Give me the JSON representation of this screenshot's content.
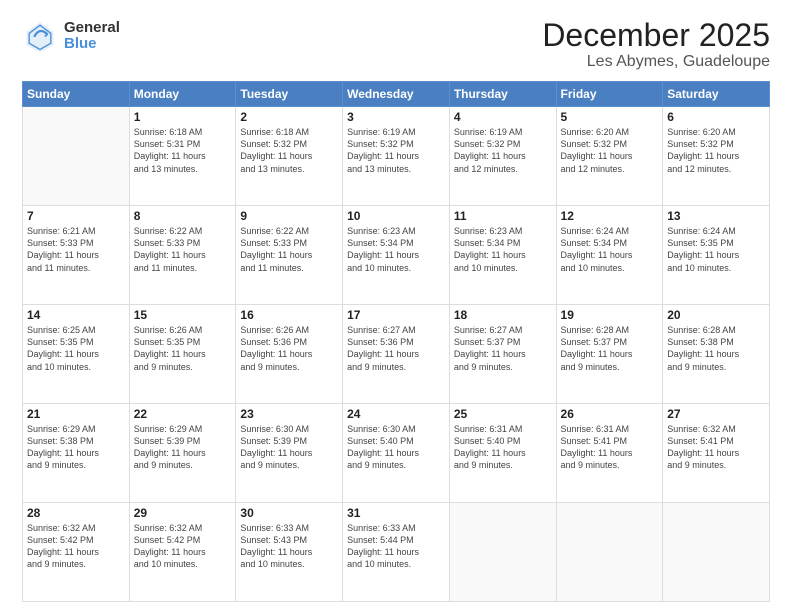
{
  "logo": {
    "general": "General",
    "blue": "Blue"
  },
  "title": "December 2025",
  "location": "Les Abymes, Guadeloupe",
  "headers": [
    "Sunday",
    "Monday",
    "Tuesday",
    "Wednesday",
    "Thursday",
    "Friday",
    "Saturday"
  ],
  "weeks": [
    [
      {
        "day": "",
        "info": ""
      },
      {
        "day": "1",
        "info": "Sunrise: 6:18 AM\nSunset: 5:31 PM\nDaylight: 11 hours\nand 13 minutes."
      },
      {
        "day": "2",
        "info": "Sunrise: 6:18 AM\nSunset: 5:32 PM\nDaylight: 11 hours\nand 13 minutes."
      },
      {
        "day": "3",
        "info": "Sunrise: 6:19 AM\nSunset: 5:32 PM\nDaylight: 11 hours\nand 13 minutes."
      },
      {
        "day": "4",
        "info": "Sunrise: 6:19 AM\nSunset: 5:32 PM\nDaylight: 11 hours\nand 12 minutes."
      },
      {
        "day": "5",
        "info": "Sunrise: 6:20 AM\nSunset: 5:32 PM\nDaylight: 11 hours\nand 12 minutes."
      },
      {
        "day": "6",
        "info": "Sunrise: 6:20 AM\nSunset: 5:32 PM\nDaylight: 11 hours\nand 12 minutes."
      }
    ],
    [
      {
        "day": "7",
        "info": "Sunrise: 6:21 AM\nSunset: 5:33 PM\nDaylight: 11 hours\nand 11 minutes."
      },
      {
        "day": "8",
        "info": "Sunrise: 6:22 AM\nSunset: 5:33 PM\nDaylight: 11 hours\nand 11 minutes."
      },
      {
        "day": "9",
        "info": "Sunrise: 6:22 AM\nSunset: 5:33 PM\nDaylight: 11 hours\nand 11 minutes."
      },
      {
        "day": "10",
        "info": "Sunrise: 6:23 AM\nSunset: 5:34 PM\nDaylight: 11 hours\nand 10 minutes."
      },
      {
        "day": "11",
        "info": "Sunrise: 6:23 AM\nSunset: 5:34 PM\nDaylight: 11 hours\nand 10 minutes."
      },
      {
        "day": "12",
        "info": "Sunrise: 6:24 AM\nSunset: 5:34 PM\nDaylight: 11 hours\nand 10 minutes."
      },
      {
        "day": "13",
        "info": "Sunrise: 6:24 AM\nSunset: 5:35 PM\nDaylight: 11 hours\nand 10 minutes."
      }
    ],
    [
      {
        "day": "14",
        "info": "Sunrise: 6:25 AM\nSunset: 5:35 PM\nDaylight: 11 hours\nand 10 minutes."
      },
      {
        "day": "15",
        "info": "Sunrise: 6:26 AM\nSunset: 5:35 PM\nDaylight: 11 hours\nand 9 minutes."
      },
      {
        "day": "16",
        "info": "Sunrise: 6:26 AM\nSunset: 5:36 PM\nDaylight: 11 hours\nand 9 minutes."
      },
      {
        "day": "17",
        "info": "Sunrise: 6:27 AM\nSunset: 5:36 PM\nDaylight: 11 hours\nand 9 minutes."
      },
      {
        "day": "18",
        "info": "Sunrise: 6:27 AM\nSunset: 5:37 PM\nDaylight: 11 hours\nand 9 minutes."
      },
      {
        "day": "19",
        "info": "Sunrise: 6:28 AM\nSunset: 5:37 PM\nDaylight: 11 hours\nand 9 minutes."
      },
      {
        "day": "20",
        "info": "Sunrise: 6:28 AM\nSunset: 5:38 PM\nDaylight: 11 hours\nand 9 minutes."
      }
    ],
    [
      {
        "day": "21",
        "info": "Sunrise: 6:29 AM\nSunset: 5:38 PM\nDaylight: 11 hours\nand 9 minutes."
      },
      {
        "day": "22",
        "info": "Sunrise: 6:29 AM\nSunset: 5:39 PM\nDaylight: 11 hours\nand 9 minutes."
      },
      {
        "day": "23",
        "info": "Sunrise: 6:30 AM\nSunset: 5:39 PM\nDaylight: 11 hours\nand 9 minutes."
      },
      {
        "day": "24",
        "info": "Sunrise: 6:30 AM\nSunset: 5:40 PM\nDaylight: 11 hours\nand 9 minutes."
      },
      {
        "day": "25",
        "info": "Sunrise: 6:31 AM\nSunset: 5:40 PM\nDaylight: 11 hours\nand 9 minutes."
      },
      {
        "day": "26",
        "info": "Sunrise: 6:31 AM\nSunset: 5:41 PM\nDaylight: 11 hours\nand 9 minutes."
      },
      {
        "day": "27",
        "info": "Sunrise: 6:32 AM\nSunset: 5:41 PM\nDaylight: 11 hours\nand 9 minutes."
      }
    ],
    [
      {
        "day": "28",
        "info": "Sunrise: 6:32 AM\nSunset: 5:42 PM\nDaylight: 11 hours\nand 9 minutes."
      },
      {
        "day": "29",
        "info": "Sunrise: 6:32 AM\nSunset: 5:42 PM\nDaylight: 11 hours\nand 10 minutes."
      },
      {
        "day": "30",
        "info": "Sunrise: 6:33 AM\nSunset: 5:43 PM\nDaylight: 11 hours\nand 10 minutes."
      },
      {
        "day": "31",
        "info": "Sunrise: 6:33 AM\nSunset: 5:44 PM\nDaylight: 11 hours\nand 10 minutes."
      },
      {
        "day": "",
        "info": ""
      },
      {
        "day": "",
        "info": ""
      },
      {
        "day": "",
        "info": ""
      }
    ]
  ]
}
